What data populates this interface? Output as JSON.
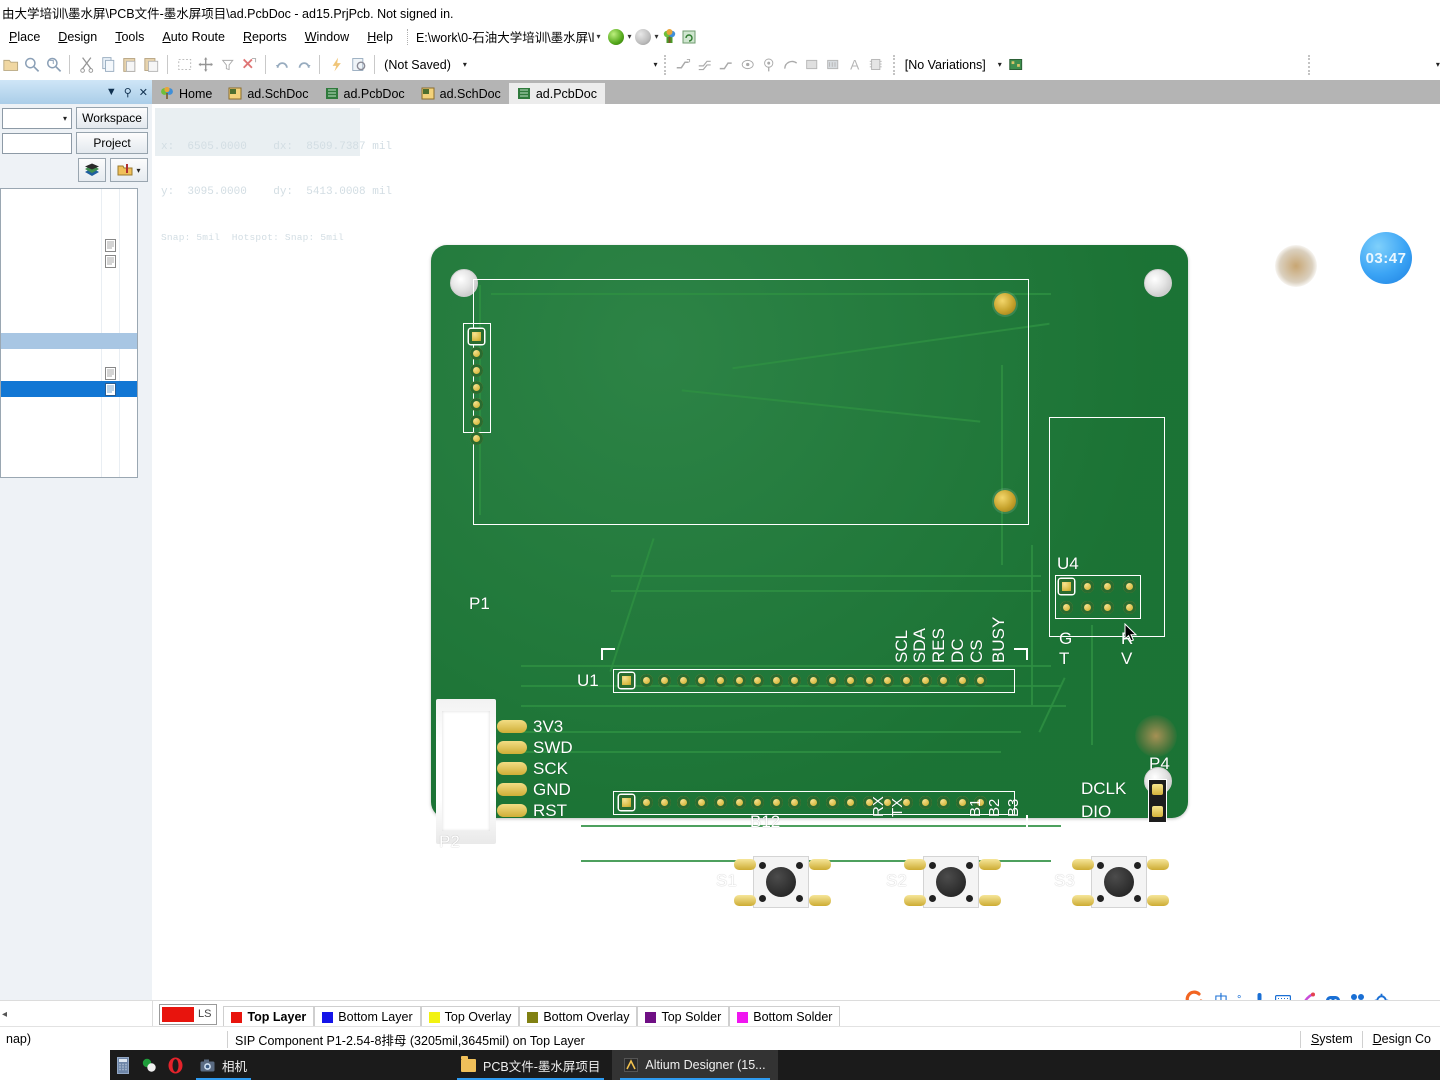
{
  "window": {
    "title": "由大学培训\\墨水屏\\PCB文件-墨水屏项目\\ad.PcbDoc - ad15.PrjPcb. Not signed in."
  },
  "menubar": {
    "items": [
      {
        "label": "Place",
        "accel": "P"
      },
      {
        "label": "Design",
        "accel": "D"
      },
      {
        "label": "Tools",
        "accel": "T"
      },
      {
        "label": "Auto Route",
        "accel": "A"
      },
      {
        "label": "Reports",
        "accel": "R"
      },
      {
        "label": "Window",
        "accel": "W"
      },
      {
        "label": "Help",
        "accel": "H"
      }
    ],
    "path": "E:\\work\\0-石油大学培训\\墨水屏\\l",
    "nav_back_title": "Back",
    "nav_forward_title": "Forward",
    "home_title": "Home"
  },
  "toolbar": {
    "saved_state": "(Not Saved)",
    "variations": "[No Variations]"
  },
  "panel": {
    "collapse_label": "▼",
    "pin_label": "⚲",
    "close_label": "✕",
    "workspace_button": "Workspace",
    "project_button": "Project"
  },
  "tabs": [
    {
      "label": "Home",
      "icon": "home-tree-icon",
      "active": false
    },
    {
      "label": "ad.SchDoc",
      "icon": "sch-doc-icon",
      "active": false
    },
    {
      "label": "ad.PcbDoc",
      "icon": "pcb-doc-icon",
      "active": false
    },
    {
      "label": "ad.SchDoc",
      "icon": "sch-doc-icon",
      "active": false
    },
    {
      "label": "ad.PcbDoc",
      "icon": "pcb-doc-icon",
      "active": true
    }
  ],
  "canvas": {
    "coords": {
      "line1": "x:  6505.0000    dx:  8509.7387 mil",
      "line2": "y:  3095.0000    dy:  5413.0008 mil",
      "line3": "Snap: 5mil  Hotspot: Snap: 5mil"
    },
    "timer": "03:47"
  },
  "pcb": {
    "designators": {
      "p1": "P1",
      "p2": "P2",
      "p4": "P4",
      "u1": "U1",
      "u4": "U4",
      "s1": "S1",
      "s2": "S2",
      "s3": "S3",
      "b12": "B12"
    },
    "u1_pin_labels": [
      "SCL",
      "SDA",
      "RES",
      "DC",
      "CS",
      "BUSY"
    ],
    "b12_pin_labels": [
      "RX",
      "TX",
      "B1",
      "B2",
      "B3"
    ],
    "p2_pin_labels": [
      "3V3",
      "SWD",
      "SCK",
      "GND",
      "RST"
    ],
    "u4_labels": [
      "G",
      "T",
      "R",
      "V"
    ],
    "p4_labels": [
      "DCLK",
      "DIO"
    ]
  },
  "layerbar": {
    "layer_set": "LS",
    "layer_set_color": "#e8140d",
    "tabs": [
      {
        "label": "Top Layer",
        "color": "#e8140d",
        "active": true
      },
      {
        "label": "Bottom Layer",
        "color": "#1414e8",
        "active": false
      },
      {
        "label": "Top Overlay",
        "color": "#f2f211",
        "active": false
      },
      {
        "label": "Bottom Overlay",
        "color": "#808012",
        "active": false
      },
      {
        "label": "Top Solder",
        "color": "#6f0f84",
        "active": false
      },
      {
        "label": "Bottom Solder",
        "color": "#f016f0",
        "active": false
      }
    ]
  },
  "statusbar": {
    "left": "nap)",
    "message": "SIP Component P1-2.54-8排母 (3205mil,3645mil) on Top Layer",
    "buttons": [
      {
        "label": "System",
        "accel": "S"
      },
      {
        "label": "Design Co",
        "accel": "D"
      }
    ]
  },
  "tray": {
    "icons": [
      "sogou-logo-icon",
      "chinese-input-icon",
      "punctuation-icon",
      "microphone-icon",
      "keyboard-icon",
      "ink-brush-icon",
      "emoji-icon",
      "apps-grid-icon",
      "settings-gear-icon"
    ],
    "chinese_label": "中"
  },
  "taskbar": {
    "items": [
      {
        "label": "相机",
        "icon": "camera-icon",
        "active": false,
        "underline": true
      },
      {
        "label": "PCB文件-墨水屏项目",
        "icon": "folder-icon",
        "active": false,
        "underline": true
      },
      {
        "label": "Altium Designer (15...",
        "icon": "altium-icon",
        "active": true,
        "underline": true
      }
    ],
    "pinned": [
      "calculator-icon",
      "app-green-icon",
      "opera-icon"
    ]
  }
}
